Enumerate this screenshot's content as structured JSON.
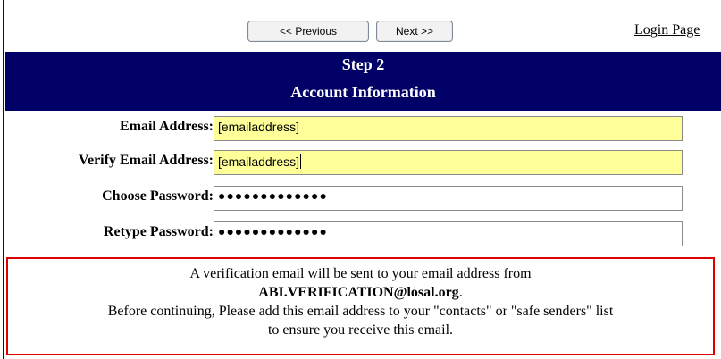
{
  "nav": {
    "previous_label": "<< Previous",
    "next_label": "Next >>",
    "login_link": "Login Page"
  },
  "header": {
    "step": "Step 2",
    "title": "Account Information"
  },
  "form": {
    "email": {
      "label": "Email Address:",
      "value": "[emailaddress]"
    },
    "verify_email": {
      "label": "Verify Email Address:",
      "value": "[emailaddress]"
    },
    "password": {
      "label": "Choose Password:",
      "value": "●●●●●●●●●●●●●"
    },
    "retype_password": {
      "label": "Retype Password:",
      "value": "●●●●●●●●●●●●●"
    }
  },
  "notice": {
    "line1": "A verification email will be sent to your email address from",
    "address": "ABI.VERIFICATION@losal.org",
    "address_suffix": ".",
    "line3": "Before continuing, Please add this email address to your \"contacts\" or \"safe senders\" list",
    "line4": "to ensure you receive this email."
  },
  "colors": {
    "header_bg": "#000066",
    "highlight_field": "#ffff99",
    "notice_border": "#dd0000"
  }
}
